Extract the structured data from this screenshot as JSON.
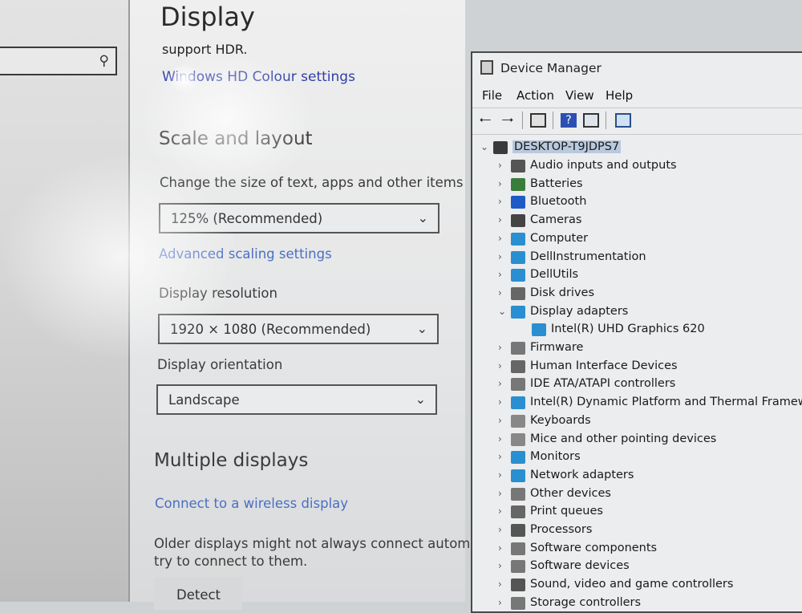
{
  "settings": {
    "page_title": "Display",
    "hdr_note": "support HDR.",
    "hdr_link": "Windows HD Colour settings",
    "scale_heading": "Scale and layout",
    "scale_label": "Change the size of text, apps and other items",
    "scale_value": "125% (Recommended)",
    "advanced_scaling_link": "Advanced scaling settings",
    "resolution_label": "Display resolution",
    "resolution_value": "1920 × 1080 (Recommended)",
    "orientation_label": "Display orientation",
    "orientation_value": "Landscape",
    "multiple_heading": "Multiple displays",
    "wireless_link": "Connect to a wireless display",
    "older_text_line1": "Older displays might not always connect automati",
    "older_text_line2": "try to connect to them.",
    "detect_button": "Detect",
    "search_icon": "search-icon"
  },
  "device_manager": {
    "title": "Device Manager",
    "menu": [
      "File",
      "Action",
      "View",
      "Help"
    ],
    "root": "DESKTOP-T9JDPS7",
    "categories": [
      {
        "label": "Audio inputs and outputs",
        "expanded": false,
        "icon": "speaker-icon",
        "color": "#555555"
      },
      {
        "label": "Batteries",
        "expanded": false,
        "icon": "battery-icon",
        "color": "#3a7d3a"
      },
      {
        "label": "Bluetooth",
        "expanded": false,
        "icon": "bluetooth-icon",
        "color": "#1e5bc6"
      },
      {
        "label": "Cameras",
        "expanded": false,
        "icon": "camera-icon",
        "color": "#444444"
      },
      {
        "label": "Computer",
        "expanded": false,
        "icon": "computer-icon",
        "color": "#2a8fd0"
      },
      {
        "label": "DellInstrumentation",
        "expanded": false,
        "icon": "monitor-icon",
        "color": "#2a8fd0"
      },
      {
        "label": "DellUtils",
        "expanded": false,
        "icon": "monitor-icon",
        "color": "#2a8fd0"
      },
      {
        "label": "Disk drives",
        "expanded": false,
        "icon": "disk-icon",
        "color": "#666666"
      },
      {
        "label": "Display adapters",
        "expanded": true,
        "icon": "display-adapter-icon",
        "color": "#2a8fd0"
      },
      {
        "label": "Intel(R) UHD Graphics 620",
        "child": true,
        "icon": "display-adapter-icon",
        "color": "#2a8fd0"
      },
      {
        "label": "Firmware",
        "expanded": false,
        "icon": "chip-icon",
        "color": "#777777"
      },
      {
        "label": "Human Interface Devices",
        "expanded": false,
        "icon": "hid-icon",
        "color": "#666666"
      },
      {
        "label": "IDE ATA/ATAPI controllers",
        "expanded": false,
        "icon": "controller-icon",
        "color": "#777777"
      },
      {
        "label": "Intel(R) Dynamic Platform and Thermal Framework",
        "expanded": false,
        "icon": "chip-icon",
        "color": "#2a8fd0"
      },
      {
        "label": "Keyboards",
        "expanded": false,
        "icon": "keyboard-icon",
        "color": "#888888"
      },
      {
        "label": "Mice and other pointing devices",
        "expanded": false,
        "icon": "mouse-icon",
        "color": "#888888"
      },
      {
        "label": "Monitors",
        "expanded": false,
        "icon": "monitor-icon",
        "color": "#2a8fd0"
      },
      {
        "label": "Network adapters",
        "expanded": false,
        "icon": "network-icon",
        "color": "#2a8fd0"
      },
      {
        "label": "Other devices",
        "expanded": false,
        "icon": "unknown-device-icon",
        "color": "#777777"
      },
      {
        "label": "Print queues",
        "expanded": false,
        "icon": "printer-icon",
        "color": "#666666"
      },
      {
        "label": "Processors",
        "expanded": false,
        "icon": "processor-icon",
        "color": "#555555"
      },
      {
        "label": "Software components",
        "expanded": false,
        "icon": "puzzle-icon",
        "color": "#777777"
      },
      {
        "label": "Software devices",
        "expanded": false,
        "icon": "puzzle-icon",
        "color": "#777777"
      },
      {
        "label": "Sound, video and game controllers",
        "expanded": false,
        "icon": "speaker-icon",
        "color": "#555555"
      },
      {
        "label": "Storage controllers",
        "expanded": false,
        "icon": "controller-icon",
        "color": "#777777"
      }
    ]
  }
}
